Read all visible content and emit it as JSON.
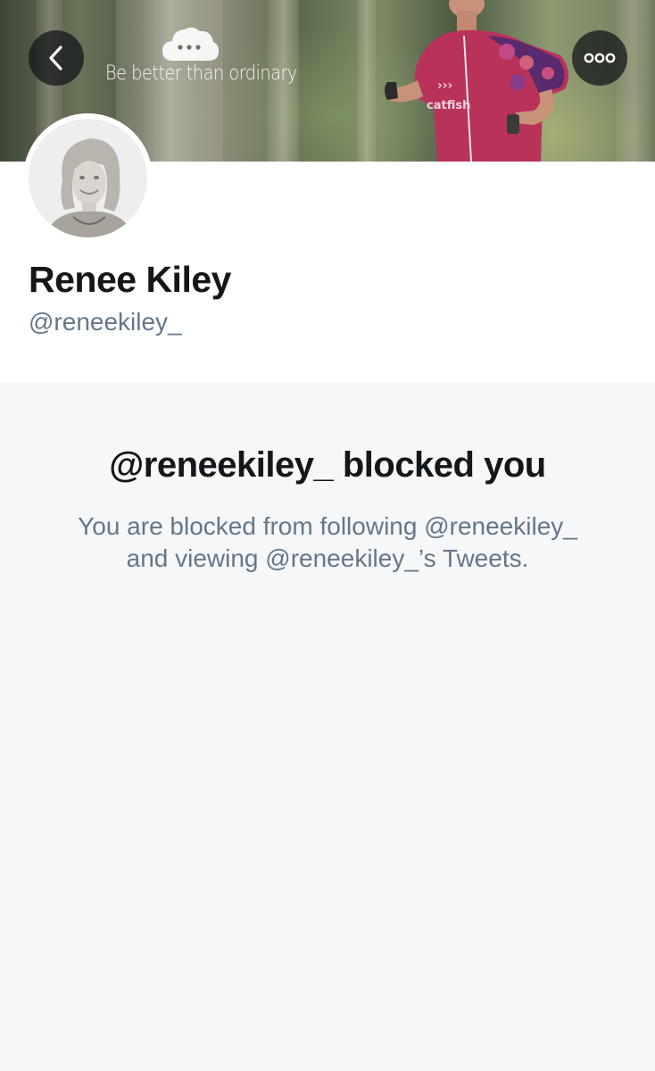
{
  "banner": {
    "tagline": "Be better than ordinary",
    "logo_icon": "cloud-chat-icon",
    "back_icon": "chevron-left-icon",
    "more_icon": "more-horizontal-icon"
  },
  "profile": {
    "display_name": "Renee Kiley",
    "handle": "@reneekiley_",
    "avatar_icon": "avatar"
  },
  "blocked": {
    "title": "@reneekiley_ blocked you",
    "description_line1": "You are blocked from following @reneekiley_",
    "description_line2": "and viewing @reneekiley_’s Tweets."
  },
  "colors": {
    "text_primary": "#14171a",
    "text_secondary": "#657786",
    "blocked_background": "#f5f7f9",
    "overlay_button": "#14171a"
  }
}
